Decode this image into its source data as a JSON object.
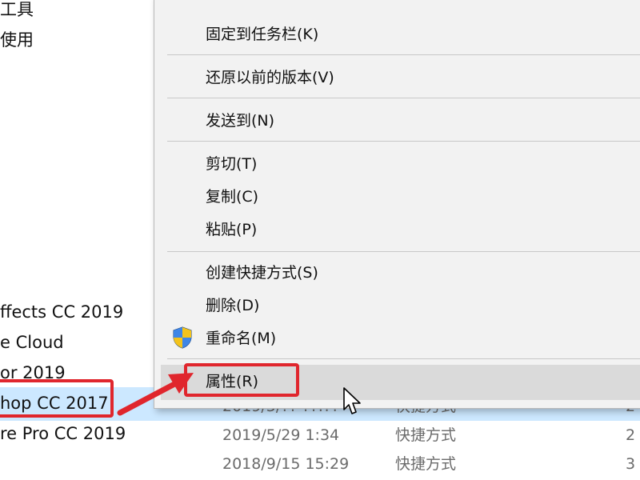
{
  "left_panel": {
    "items": [
      "工具",
      "使用",
      "ffects CC 2019",
      "e Cloud",
      "or 2019",
      "hop CC 2017",
      "re Pro CC 2019"
    ]
  },
  "file_rows": [
    {
      "date": "2019/5/?? ??:??",
      "type": "快捷方式",
      "size": "2"
    },
    {
      "date": "2019/5/29 1:34",
      "type": "快捷方式",
      "size": "2"
    },
    {
      "date": "2018/9/15 15:29",
      "type": "快捷方式",
      "size": "3"
    }
  ],
  "context_menu": {
    "items": [
      {
        "label": "固定到任务栏(K)"
      },
      {
        "label": "还原以前的版本(V)"
      },
      {
        "label": "发送到(N)"
      },
      {
        "label": "剪切(T)"
      },
      {
        "label": "复制(C)"
      },
      {
        "label": "粘贴(P)"
      },
      {
        "label": "创建快捷方式(S)"
      },
      {
        "label": "删除(D)"
      },
      {
        "label": "重命名(M)",
        "icon": "uac-shield-icon"
      },
      {
        "label": "属性(R)",
        "highlighted": true
      }
    ]
  },
  "annotation": {
    "color": "#e0262d",
    "icons": [
      "red-arrow-icon",
      "mouse-cursor-icon"
    ]
  },
  "colors": {
    "selection_row": "#cce8ff",
    "menu_bg": "#f2f2f2",
    "menu_highlight": "#dadada"
  }
}
